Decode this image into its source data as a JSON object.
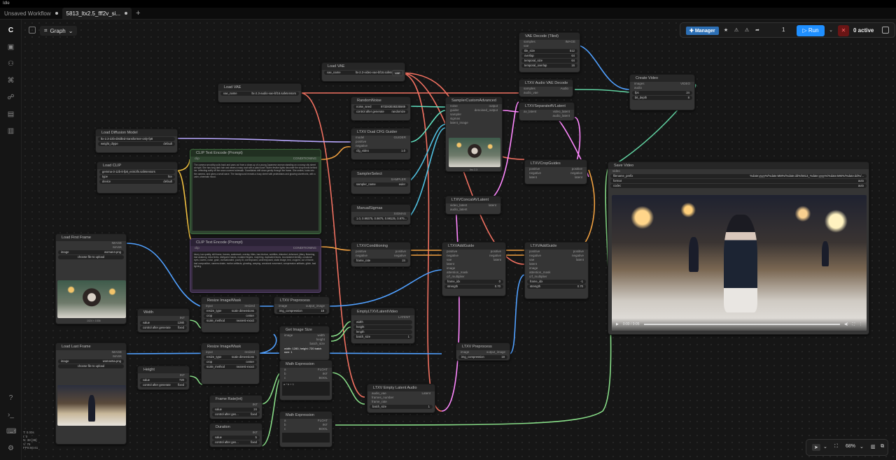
{
  "app": {
    "title": "Idle"
  },
  "tabs": [
    {
      "label": "Unsaved Workflow"
    },
    {
      "label": "5813_ltx2.5_fff2v_si..."
    }
  ],
  "canvas": {
    "graph_label": "Graph"
  },
  "toolbar": {
    "manager_label": "Manager",
    "queue_count": "1",
    "run_label": "Run",
    "active_label": "0 active"
  },
  "zoom": {
    "level": "68%"
  },
  "stats": {
    "l1": "T: 0.00s",
    "l2": "I: 0",
    "l3": "N: 38 [38]",
    "l4": "V: 76",
    "l5": "FPS:60.61"
  },
  "nodes": {
    "load_vae_1": {
      "title": "Load VAE",
      "w1_k": "vae_name",
      "w1_v": "ltx-2.3-video-vae-bf16.safetensors",
      "out": "VAE"
    },
    "load_vae_2": {
      "title": "Load VAE",
      "w1_k": "vae_name",
      "w1_v": "ltx-2.3-audio-vae-bf16.safetensors",
      "out": "VAE"
    },
    "load_diffusion": {
      "title": "Load Diffusion Model",
      "w1_k": "unet_name",
      "w1_v": "ltx-2.3-22b-distilled-transformer-only-fp8",
      "w2_k": "weight_dtype",
      "w2_v": "default",
      "out": "MODEL"
    },
    "load_clip": {
      "title": "Load CLIP",
      "w1_v": "gemma-3-12b-it-fp8_e4m3fn.safetensors",
      "w2_k": "type",
      "w2_v": "ltxv",
      "w3_k": "device",
      "w3_v": "default",
      "out": "CLIP"
    },
    "clip_pos": {
      "title": "CLIP Text Encode (Prompt)",
      "in": "clip",
      "out": "CONDITIONING",
      "text": "The camera smoothly pulls back and pans out from a close-up of a young Japanese woman standing on a snowy city street at night. She has long dark hair and wears a navy coat with a plaid scarf. Warm festive lights decorate the shop fronts behind her, reflecting softly off the snow-covered sidewalk. Snowflakes drift down gently through the frame. She smiles, looks into the camera, and gives a small wave. The background reveals a busy street with pedestrians and glowing storefronts, with a calm, cinematic mood."
    },
    "clip_neg": {
      "title": "CLIP Text Encode (Prompt)",
      "in": "clip",
      "out": "CONDITIONING",
      "text": "blurry, low quality, still frame, frames, watermark, overlay, titles, has blurbox, subtitles, distorted, deformed, jittery, flickering, bad anatomy, extra limbs, disfigured hands, mutated fingers, morphing, duplicated faces, inconsistent identity, unnatural eyes, lowres, noise, grain, oversaturated, poorly lit, overexposed, underexposed, static image, text, cropped, out of frame, bad composition, camera shake, motion artifacts, ghosting, warping, unnatural movement, compression artifacts, glitch, bad lighting."
    },
    "random_noise": {
      "title": "RandomNoise",
      "w1_k": "noise_seed",
      "w1_v": "873283038335569",
      "w2_k": "control after generate",
      "w2_v": "randomize",
      "out": "NOISE"
    },
    "dual_cfg": {
      "title": "LTXV Dual CFG Guider",
      "in1": "model",
      "in2": "positive",
      "in3": "negative",
      "w1_k": "cfg_video",
      "w1_v": "1.0",
      "w2_k": "cfg_audio",
      "w2_v": "1.0",
      "out": "GUIDER"
    },
    "sampler_select": {
      "title": "SamplerSelect",
      "w1_k": "sampler_name",
      "w1_v": "euler",
      "out": "SAMPLER"
    },
    "manual_sigmas": {
      "title": "ManualSigmas",
      "w1_v": "1.0, 0.99375, 0.9875, 0.98125, 0.975...",
      "out": "SIGMAS"
    },
    "sampler_custom": {
      "title": "SamplerCustomAdvanced",
      "in1": "noise",
      "in2": "guider",
      "in3": "sampler",
      "in4": "sigmas",
      "in5": "latent_image",
      "out1": "output",
      "out2": "denoised_output",
      "caption": "ltxv 2.3"
    },
    "vae_decode": {
      "title": "VAE Decode (Tiled)",
      "in1": "samples",
      "in2": "vae",
      "w1_k": "tile_size",
      "w1_v": "512",
      "w2_k": "overlap",
      "w2_v": "64",
      "w3_k": "temporal_size",
      "w3_v": "64",
      "w4_k": "temporal_overlap",
      "w4_v": "16",
      "out": "IMAGE"
    },
    "audio_decode": {
      "title": "LTXV Audio VAE Decode",
      "in1": "samples",
      "in2": "audio_vae",
      "out": "Audio"
    },
    "separate_av": {
      "title": "LTXVSeparateAVLatent",
      "in": "av_latent",
      "out1": "video_latent",
      "out2": "audio_latent"
    },
    "create_video": {
      "title": "Create Video",
      "in1": "images",
      "in2": "audio",
      "w1_k": "fps",
      "w1_v": "24",
      "w2_k": "bit_depth",
      "w2_v": "8",
      "out": "VIDEO"
    },
    "crop_guides": {
      "title": "LTXVCropGuides",
      "in1": "positive",
      "in2": "negative",
      "in3": "latent",
      "out1": "positive",
      "out2": "negative",
      "out3": "latent"
    },
    "concat_av": {
      "title": "LTXVConcatAVLatent",
      "in1": "video_latent",
      "in2": "audio_latent",
      "out": "latent"
    },
    "save_video": {
      "title": "Save Video",
      "in": "video",
      "w1_k": "filename_prefix",
      "w1_v": "%date:yyyy%/%date:MM%/%date:dd%/5813_%date:yyyy%/%date:MM%/%date:dd%/...",
      "w2_k": "format",
      "w2_v": "auto",
      "w3_k": "codec",
      "w3_v": "auto",
      "time": "0:00 / 0:05"
    },
    "conditioning": {
      "title": "LTXVConditioning",
      "in1": "positive",
      "in2": "negative",
      "w1_k": "frame_rate",
      "w1_v": "24",
      "out1": "positive",
      "out2": "negative"
    },
    "add_guide_1": {
      "title": "LTXVAddGuide",
      "in1": "positive",
      "in2": "negative",
      "in3": "vae",
      "in4": "latent",
      "in5": "image",
      "in6": "attention_mask",
      "in7": "crf_multiplier",
      "w1_k": "frame_idx",
      "w1_v": "0",
      "w2_k": "strength",
      "w2_v": "0.70",
      "out1": "positive",
      "out2": "negative",
      "out3": "latent"
    },
    "add_guide_2": {
      "title": "LTXVAddGuide",
      "in1": "positive",
      "in2": "negative",
      "in3": "vae",
      "in4": "latent",
      "in5": "image",
      "in6": "attention_mask",
      "in7": "crf_multiplier",
      "w1_k": "frame_idx",
      "w1_v": "-1",
      "w2_k": "strength",
      "w2_v": "0.70",
      "out1": "positive",
      "out2": "negative",
      "out3": "latent"
    },
    "load_first": {
      "title": "Load First Frame",
      "w1_k": "image",
      "w1_v": "woman4.png",
      "upload": "choose file to upload",
      "out1": "IMAGE",
      "out2": "MASK",
      "caption": "1024 × 1536"
    },
    "load_last": {
      "title": "Load Last Frame",
      "w1_k": "image",
      "w1_v": "woman5a.png",
      "upload": "choose file to upload",
      "out1": "IMAGE",
      "out2": "MASK",
      "caption": "1024 × 1536"
    },
    "width": {
      "title": "Width",
      "w1_k": "value",
      "w1_v": "1280",
      "w2_k": "control after generate",
      "w2_v": "fixed",
      "out": "INT"
    },
    "height": {
      "title": "Height",
      "w1_k": "value",
      "w1_v": "720",
      "w2_k": "control after generate",
      "w2_v": "fixed",
      "out": "INT"
    },
    "resize_1": {
      "title": "Resize Image/Mask",
      "in": "input",
      "w1_k": "resize_type",
      "w1_v": "scale dimensions",
      "w2_k": "crop",
      "w2_v": "center",
      "w3_k": "scale_method",
      "w3_v": "nearest-exact",
      "out": "resized"
    },
    "resize_2": {
      "title": "Resize Image/Mask",
      "in": "input",
      "w1_k": "resize_type",
      "w1_v": "scale dimensions",
      "w2_k": "crop",
      "w2_v": "center",
      "w3_k": "scale_method",
      "w3_v": "nearest-exact",
      "out": "resized"
    },
    "preprocess_1": {
      "title": "LTXV Preprocess",
      "in": "image",
      "w1_k": "img_compression",
      "w1_v": "18",
      "out": "output_image"
    },
    "preprocess_2": {
      "title": "LTXV Preprocess",
      "in": "image",
      "w1_k": "img_compression",
      "w1_v": "18",
      "out": "output_image"
    },
    "empty_latent": {
      "title": "EmptyLTXVLatentVideo",
      "in1": "width",
      "in2": "height",
      "in3": "length",
      "w1_k": "batch_size",
      "w1_v": "1",
      "out": "LATENT"
    },
    "get_size": {
      "title": "Get Image Size",
      "in": "image",
      "out1": "width",
      "out2": "height",
      "out3": "batch_size",
      "info": "width: 1280, height: 720 batch size: 1"
    },
    "math_1": {
      "title": "Math Expression",
      "in1": "a",
      "in2": "b",
      "in3": "c",
      "expr": "a * b + 1",
      "out1": "FLOAT",
      "out2": "INT",
      "out3": "BOOL"
    },
    "math_2": {
      "title": "Math Expression",
      "in1": "a",
      "in2": "b",
      "in3": "c",
      "out1": "FLOAT",
      "out2": "INT",
      "out3": "BOOL"
    },
    "frame_rate": {
      "title": "Frame Rate(int)",
      "w1_k": "value",
      "w1_v": "24",
      "w2_k": "control after gen...",
      "w2_v": "fixed",
      "out": "INT"
    },
    "duration": {
      "title": "Duration",
      "w1_k": "value",
      "w1_v": "5",
      "w2_k": "control after gen...",
      "w2_v": "fixed",
      "out": "INT"
    },
    "empty_audio": {
      "title": "LTXV Empty Latent Audio",
      "in1": "audio_vae",
      "in2": "frames_number",
      "in3": "frame_rate",
      "w1_k": "batch_size",
      "w1_v": "1",
      "out": "Latent"
    }
  }
}
